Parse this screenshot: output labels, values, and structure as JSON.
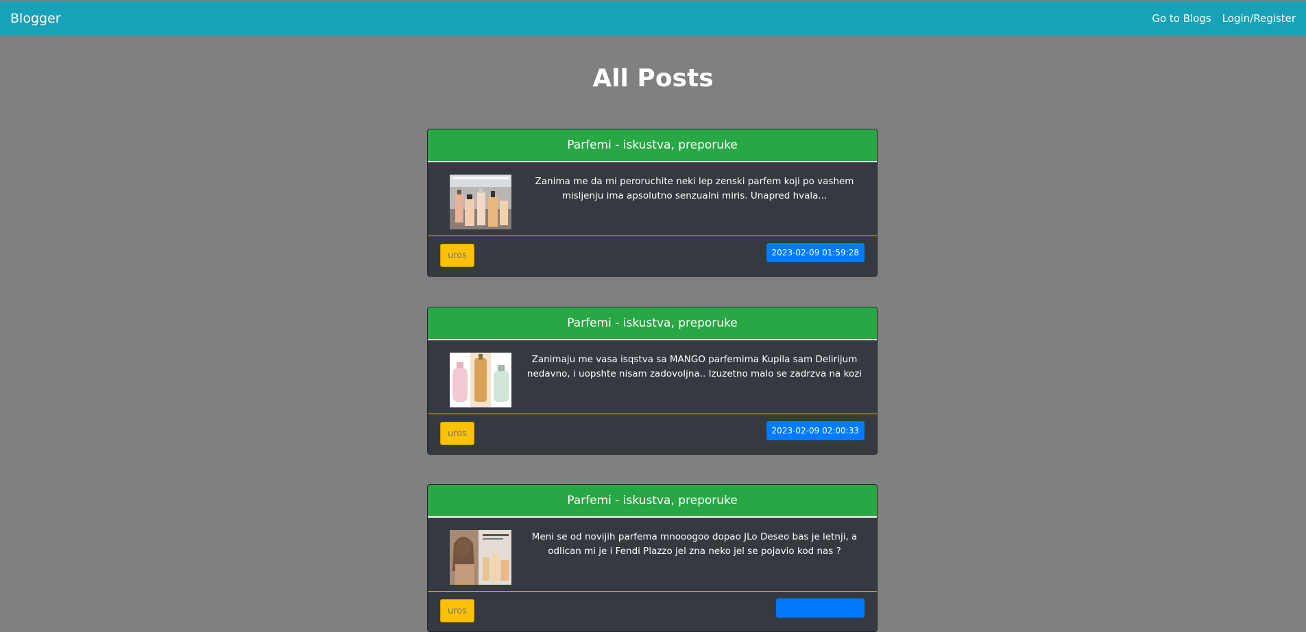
{
  "navbar": {
    "brand": "Blogger",
    "links": [
      "Go to Blogs",
      "Login/Register"
    ]
  },
  "page": {
    "title": "All Posts"
  },
  "posts": [
    {
      "header": "Parfemi - iskustva, preporuke",
      "text": "Zanima me da mi peroruchite neki lep zenski parfem koji po vashem misljenju ima apsolutno senzualni miris. Unapred hvala...",
      "author": "uros",
      "date": "2023-02-09 01:59:28"
    },
    {
      "header": "Parfemi - iskustva, preporuke",
      "text": "Zanimaju me vasa isqstva sa MANGO parfemima Kupila sam Delirijum nedavno, i uopshte nisam zadovoljna.. Izuzetno malo se zadrzva na kozi",
      "author": "uros",
      "date": "2023-02-09 02:00:33"
    },
    {
      "header": "Parfemi - iskustva, preporuke",
      "text": "Meni se od novijih parfema mnooogoo dopao JLo Deseo bas je letnji, a odlican mi je i Fendi Plazzo jel zna neko jel se pojavio kod nas ?",
      "author": "uros",
      "date": ""
    }
  ],
  "colors": {
    "navbar": "#17a2b8",
    "background": "#808080",
    "card_header": "#28a745",
    "card_body": "#343a40",
    "author_button": "#ffc107",
    "date_badge": "#007bff"
  }
}
